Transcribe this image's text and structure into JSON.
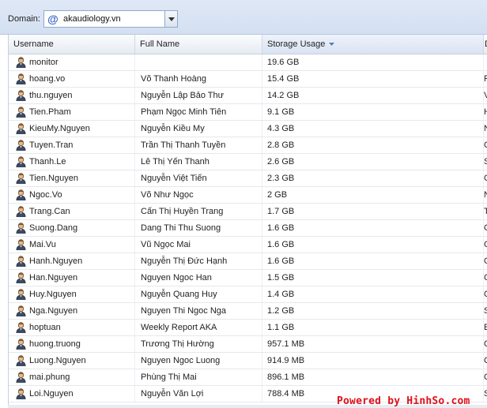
{
  "toolbar": {
    "domain_label": "Domain:",
    "domain_value": "akaudiology.vn",
    "domain_icon": "at-sign-icon"
  },
  "columns": {
    "username": "Username",
    "full_name": "Full Name",
    "storage": "Storage Usage",
    "extra": "D"
  },
  "sort": {
    "column": "storage",
    "direction": "descending"
  },
  "rows": [
    {
      "username": "monitor",
      "full_name": "",
      "storage": "19.6 GB",
      "extra": ""
    },
    {
      "username": "hoang.vo",
      "full_name": "Võ Thanh Hoàng",
      "storage": "15.4 GB",
      "extra": "F"
    },
    {
      "username": "thu.nguyen",
      "full_name": "Nguyễn Lập Bảo Thư",
      "storage": "14.2 GB",
      "extra": "V"
    },
    {
      "username": "Tien.Pham",
      "full_name": "Phạm Ngọc Minh Tiên",
      "storage": "9.1 GB",
      "extra": "H"
    },
    {
      "username": "KieuMy.Nguyen",
      "full_name": "Nguyễn Kiều My",
      "storage": "4.3 GB",
      "extra": "N"
    },
    {
      "username": "Tuyen.Tran",
      "full_name": "Trần Thị Thanh Tuyền",
      "storage": "2.8 GB",
      "extra": "C"
    },
    {
      "username": "Thanh.Le",
      "full_name": "Lê Thị Yến Thanh",
      "storage": "2.6 GB",
      "extra": "S"
    },
    {
      "username": "Tien.Nguyen",
      "full_name": "Nguyễn Việt Tiến",
      "storage": "2.3 GB",
      "extra": "C"
    },
    {
      "username": "Ngoc.Vo",
      "full_name": "Võ Như Ngọc",
      "storage": "2 GB",
      "extra": "N"
    },
    {
      "username": "Trang.Can",
      "full_name": "Cấn Thị Huyền Trang",
      "storage": "1.7 GB",
      "extra": "T"
    },
    {
      "username": "Suong.Dang",
      "full_name": "Dang Thi Thu Suong",
      "storage": "1.6 GB",
      "extra": "C"
    },
    {
      "username": "Mai.Vu",
      "full_name": "Vũ Ngọc Mai",
      "storage": "1.6 GB",
      "extra": "C"
    },
    {
      "username": "Hanh.Nguyen",
      "full_name": "Nguyễn Thị Đức Hạnh",
      "storage": "1.6 GB",
      "extra": "C"
    },
    {
      "username": "Han.Nguyen",
      "full_name": "Nguyen Ngoc Han",
      "storage": "1.5 GB",
      "extra": "C"
    },
    {
      "username": "Huy.Nguyen",
      "full_name": "Nguyễn Quang Huy",
      "storage": "1.4 GB",
      "extra": "C"
    },
    {
      "username": "Nga.Nguyen",
      "full_name": "Nguyen Thi Ngoc Nga",
      "storage": "1.2 GB",
      "extra": "S"
    },
    {
      "username": "hoptuan",
      "full_name": "Weekly Report AKA",
      "storage": "1.1 GB",
      "extra": "E"
    },
    {
      "username": "huong.truong",
      "full_name": "Trương Thị Hường",
      "storage": "957.1 MB",
      "extra": "C"
    },
    {
      "username": "Luong.Nguyen",
      "full_name": "Nguyen Ngoc Luong",
      "storage": "914.9 MB",
      "extra": "C"
    },
    {
      "username": "mai.phung",
      "full_name": "Phùng Thị Mai",
      "storage": "896.1 MB",
      "extra": "C"
    },
    {
      "username": "Loi.Nguyen",
      "full_name": "Nguyễn Văn Lợi",
      "storage": "788.4 MB",
      "extra": "S"
    }
  ],
  "watermark": "Powered by HinhSo.com",
  "colors": {
    "toolbar_bg": "#dfe8f6",
    "accent": "#3a66c4",
    "watermark": "#e0101a"
  }
}
